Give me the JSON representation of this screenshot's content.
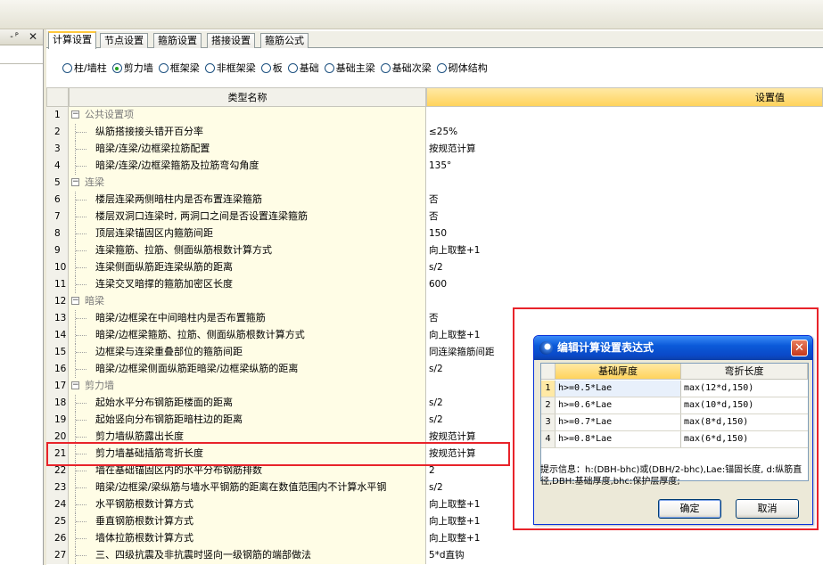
{
  "left_panel": {
    "pin_label": "-ᴾ",
    "close_label": "✕"
  },
  "tabs": [
    "计算设置",
    "节点设置",
    "箍筋设置",
    "搭接设置",
    "箍筋公式"
  ],
  "radios": [
    {
      "label": "柱/墙柱",
      "checked": false
    },
    {
      "label": "剪力墙",
      "checked": true
    },
    {
      "label": "框架梁",
      "checked": false
    },
    {
      "label": "非框架梁",
      "checked": false
    },
    {
      "label": "板",
      "checked": false
    },
    {
      "label": "基础",
      "checked": false
    },
    {
      "label": "基础主梁",
      "checked": false
    },
    {
      "label": "基础次梁",
      "checked": false
    },
    {
      "label": "砌体结构",
      "checked": false
    }
  ],
  "grid": {
    "header_name": "类型名称",
    "header_value": "设置值",
    "rows": [
      {
        "num": "1",
        "name": "公共设置项",
        "value": "",
        "group": true
      },
      {
        "num": "2",
        "name": "纵筋搭接接头错开百分率",
        "value": "≤25%",
        "group": false
      },
      {
        "num": "3",
        "name": "暗梁/连梁/边框梁拉筋配置",
        "value": "按规范计算",
        "group": false
      },
      {
        "num": "4",
        "name": "暗梁/连梁/边框梁箍筋及拉筋弯勾角度",
        "value": "135°",
        "group": false
      },
      {
        "num": "5",
        "name": "连梁",
        "value": "",
        "group": true
      },
      {
        "num": "6",
        "name": "楼层连梁两侧暗柱内是否布置连梁箍筋",
        "value": "否",
        "group": false
      },
      {
        "num": "7",
        "name": "楼层双洞口连梁时, 两洞口之间是否设置连梁箍筋",
        "value": "否",
        "group": false
      },
      {
        "num": "8",
        "name": "顶层连梁锚固区内箍筋间距",
        "value": "150",
        "group": false
      },
      {
        "num": "9",
        "name": "连梁箍筋、拉筋、侧面纵筋根数计算方式",
        "value": "向上取整+1",
        "group": false
      },
      {
        "num": "10",
        "name": "连梁侧面纵筋距连梁纵筋的距离",
        "value": "s/2",
        "group": false
      },
      {
        "num": "11",
        "name": "连梁交叉暗撑的箍筋加密区长度",
        "value": "600",
        "group": false
      },
      {
        "num": "12",
        "name": "暗梁",
        "value": "",
        "group": true
      },
      {
        "num": "13",
        "name": "暗梁/边框梁在中间暗柱内是否布置箍筋",
        "value": "否",
        "group": false
      },
      {
        "num": "14",
        "name": "暗梁/边框梁箍筋、拉筋、侧面纵筋根数计算方式",
        "value": "向上取整+1",
        "group": false
      },
      {
        "num": "15",
        "name": "边框梁与连梁重叠部位的箍筋间距",
        "value": "同连梁箍筋间距",
        "group": false
      },
      {
        "num": "16",
        "name": "暗梁/边框梁侧面纵筋距暗梁/边框梁纵筋的距离",
        "value": "s/2",
        "group": false
      },
      {
        "num": "17",
        "name": "剪力墙",
        "value": "",
        "group": true
      },
      {
        "num": "18",
        "name": "起始水平分布钢筋距楼面的距离",
        "value": "s/2",
        "group": false
      },
      {
        "num": "19",
        "name": "起始竖向分布钢筋距暗柱边的距离",
        "value": "s/2",
        "group": false
      },
      {
        "num": "20",
        "name": "剪力墙纵筋露出长度",
        "value": "按规范计算",
        "group": false
      },
      {
        "num": "21",
        "name": "剪力墙基础插筋弯折长度",
        "value": "按规范计算",
        "group": false
      },
      {
        "num": "22",
        "name": "墙在基础锚固区内的水平分布钢筋排数",
        "value": "2",
        "group": false
      },
      {
        "num": "23",
        "name": "暗梁/边框梁/梁纵筋与墙水平钢筋的距离在数值范围内不计算水平钢",
        "value": "s/2",
        "group": false
      },
      {
        "num": "24",
        "name": "水平钢筋根数计算方式",
        "value": "向上取整+1",
        "group": false
      },
      {
        "num": "25",
        "name": "垂直钢筋根数计算方式",
        "value": "向上取整+1",
        "group": false
      },
      {
        "num": "26",
        "name": "墙体拉筋根数计算方式",
        "value": "向上取整+1",
        "group": false
      },
      {
        "num": "27",
        "name": "三、四级抗震及非抗震时竖向一级钢筋的端部做法",
        "value": "5*d直钩",
        "group": false
      }
    ]
  },
  "dialog": {
    "title": "编辑计算设置表达式",
    "close_label": "✕",
    "col_a": "基础厚度",
    "col_b": "弯折长度",
    "rows": [
      {
        "num": "1",
        "a": "h>=0.5*Lae",
        "b": "max(12*d,150)",
        "selected": true
      },
      {
        "num": "2",
        "a": "h>=0.6*Lae",
        "b": "max(10*d,150)",
        "selected": false
      },
      {
        "num": "3",
        "a": "h>=0.7*Lae",
        "b": "max(8*d,150)",
        "selected": false
      },
      {
        "num": "4",
        "a": "h>=0.8*Lae",
        "b": "max(6*d,150)",
        "selected": false
      }
    ],
    "hint": "提示信息：h:(DBH-bhc)或(DBH/2-bhc),Lae:锚固长度, d:纵筋直径,DBH:基础厚度,bhc:保护层厚度;",
    "ok_label": "确定",
    "cancel_label": "取消"
  },
  "colors": {
    "highlight_red": "#e8232a",
    "header_yellow": "#ffd35c",
    "titlebar_blue": "#0b5ad9"
  }
}
